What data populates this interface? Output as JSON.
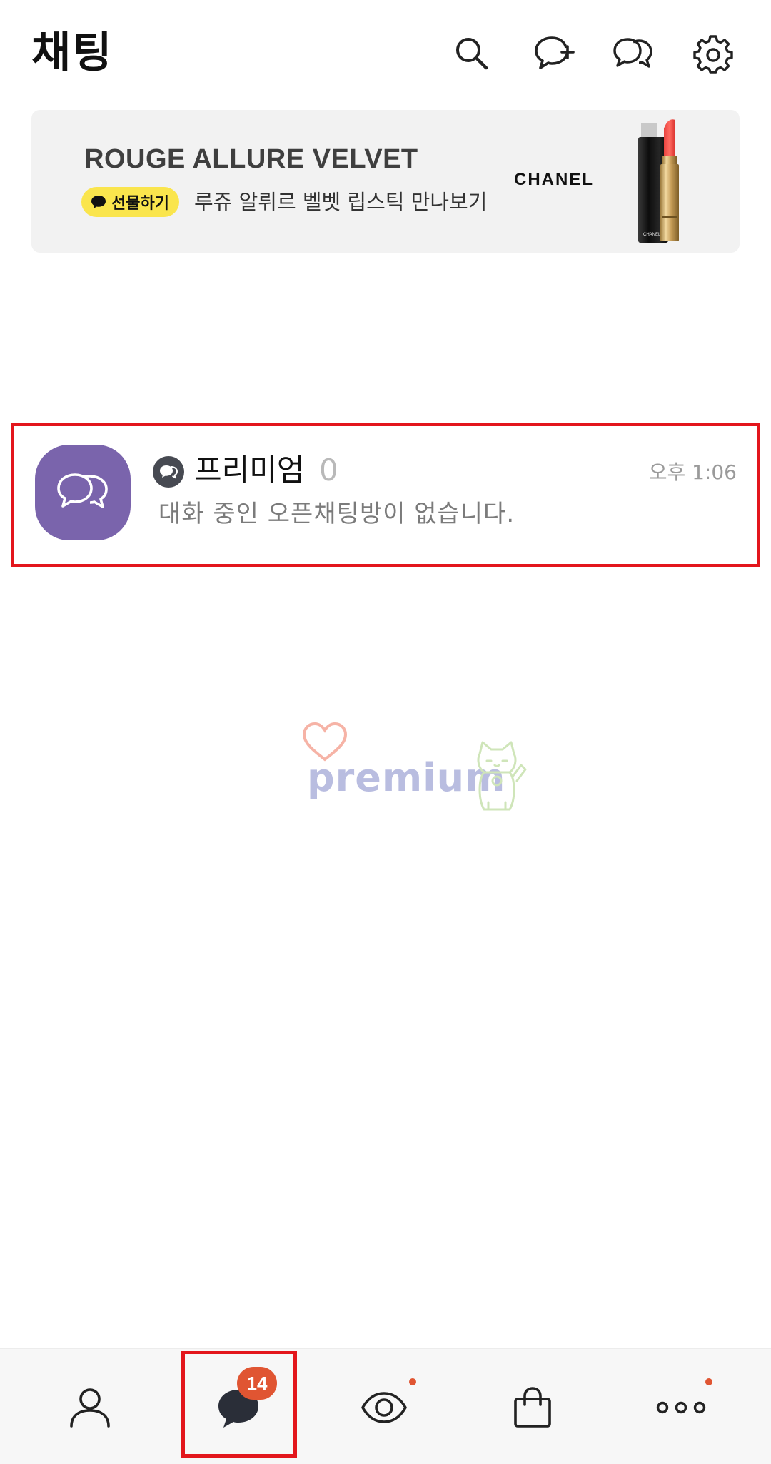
{
  "header": {
    "title": "채팅",
    "icons": [
      "search-icon",
      "new-chat-icon",
      "open-chat-icon",
      "settings-icon"
    ]
  },
  "banner": {
    "title": "ROUGE ALLURE VELVET",
    "gift_label": "선물하기",
    "subtitle": "루쥬 알뤼르 벨벳 립스틱 만나보기",
    "brand": "CHANEL",
    "product_brand": "CHANEL",
    "background_color": "#f2f2f2",
    "pill_color": "#fae54d"
  },
  "chats": [
    {
      "name": "프리미엄",
      "member_count": "0",
      "time": "오후 1:06",
      "preview": "대화 중인 오픈채팅방이 없습니다.",
      "avatar_color": "#7a64ac",
      "avatar_icon": "chat-bubbles-icon",
      "type_icon": "open-chat-icon"
    }
  ],
  "watermark": {
    "text": "premium"
  },
  "bottom_nav": {
    "items": [
      {
        "icon": "friends-icon"
      },
      {
        "icon": "chat-icon",
        "badge": "14",
        "active": true
      },
      {
        "icon": "view-icon",
        "dot": true
      },
      {
        "icon": "shopping-icon"
      },
      {
        "icon": "more-icon",
        "dot": true
      }
    ],
    "badge_color": "#e05532"
  },
  "highlight_color": "#e3161c"
}
